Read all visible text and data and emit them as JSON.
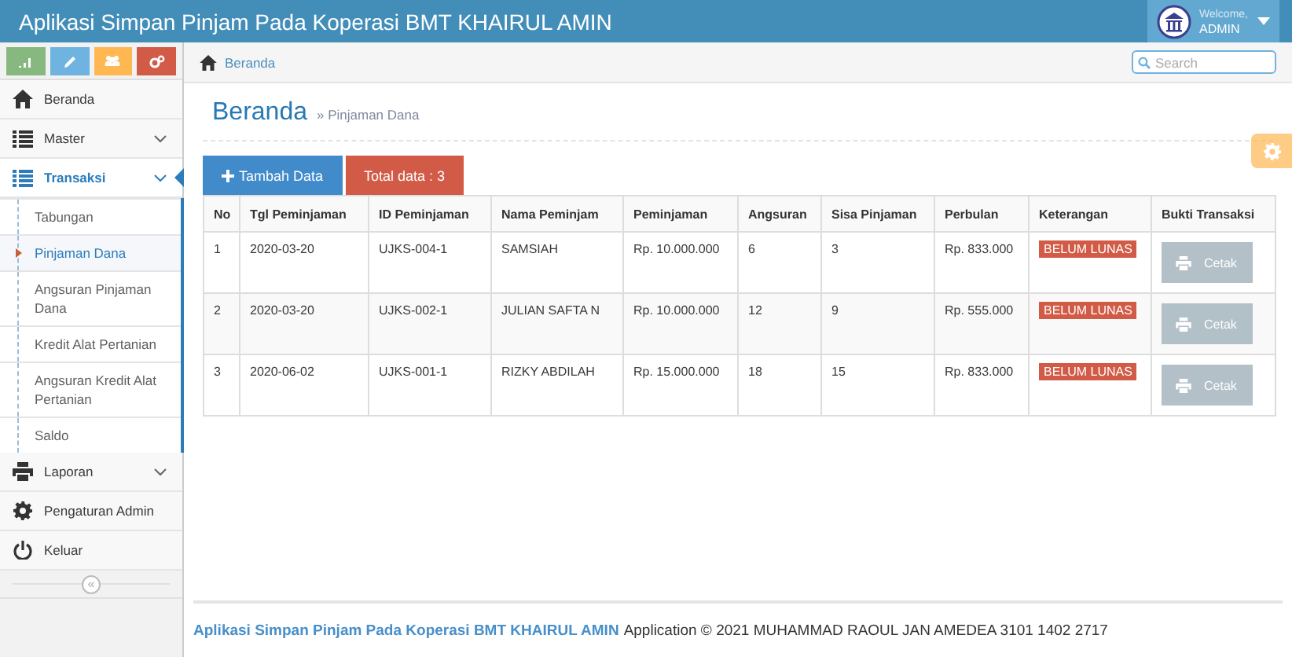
{
  "navbar": {
    "title": "Aplikasi Simpan Pinjam Pada Koperasi BMT KHAIRUL AMIN",
    "greeting": "Welcome,",
    "user": "ADMIN"
  },
  "shortcuts": [
    {
      "color": "#87b87f"
    },
    {
      "color": "#6fb3e0"
    },
    {
      "color": "#ffb752"
    },
    {
      "color": "#d15b47"
    }
  ],
  "sidebar": {
    "items": [
      {
        "label": "Beranda",
        "kind": "link",
        "selected": false
      },
      {
        "label": "Master",
        "kind": "menu",
        "expanded": false,
        "selected": false
      },
      {
        "label": "Transaksi",
        "kind": "menu",
        "expanded": true,
        "selected": true,
        "children": [
          {
            "label": "Tabungan",
            "selected": false
          },
          {
            "label": "Pinjaman Dana",
            "selected": true
          },
          {
            "label": "Angsuran Pinjaman Dana",
            "selected": false
          },
          {
            "label": "Kredit Alat Pertanian",
            "selected": false
          },
          {
            "label": "Angsuran Kredit Alat Pertanian",
            "selected": false
          },
          {
            "label": "Saldo",
            "selected": false
          }
        ]
      },
      {
        "label": "Laporan",
        "kind": "menu",
        "expanded": false,
        "selected": false
      },
      {
        "label": "Pengaturan Admin",
        "kind": "link",
        "selected": false
      },
      {
        "label": "Keluar",
        "kind": "link",
        "selected": false
      }
    ],
    "collapse": "«"
  },
  "breadcrumb": "Beranda",
  "search": {
    "placeholder": "Search"
  },
  "page": {
    "title": "Beranda",
    "subtitle": "» Pinjaman Dana"
  },
  "actions": {
    "add": "Tambah Data",
    "total": "Total data : 3"
  },
  "table": {
    "columns": [
      "No",
      "Tgl Peminjaman",
      "ID Peminjaman",
      "Nama Peminjam",
      "Peminjaman",
      "Angsuran",
      "Sisa Pinjaman",
      "Perbulan",
      "Keterangan",
      "Bukti Transaksi"
    ],
    "rows": [
      {
        "cells": [
          "1",
          "2020-03-20",
          "UJKS-004-1",
          "SAMSIAH",
          "Rp. 10.000.000",
          "6",
          "3",
          "Rp. 833.000"
        ],
        "status": "BELUM LUNAS",
        "button": "Cetak",
        "disabled": true
      },
      {
        "cells": [
          "2",
          "2020-03-20",
          "UJKS-002-1",
          "JULIAN SAFTA N",
          "Rp. 10.000.000",
          "12",
          "9",
          "Rp. 555.000"
        ],
        "status": "BELUM LUNAS",
        "button": "Cetak",
        "disabled": true
      },
      {
        "cells": [
          "3",
          "2020-06-02",
          "UJKS-001-1",
          "RIZKY ABDILAH",
          "Rp. 15.000.000",
          "18",
          "15",
          "Rp. 833.000"
        ],
        "status": "BELUM LUNAS",
        "button": "Cetak",
        "disabled": true
      }
    ]
  },
  "footer": {
    "brand": "Aplikasi Simpan Pinjam Pada Koperasi BMT KHAIRUL AMIN",
    "text": "Application © 2021 MUHAMMAD RAOUL JAN AMEDEA 3101 1402 2717"
  }
}
